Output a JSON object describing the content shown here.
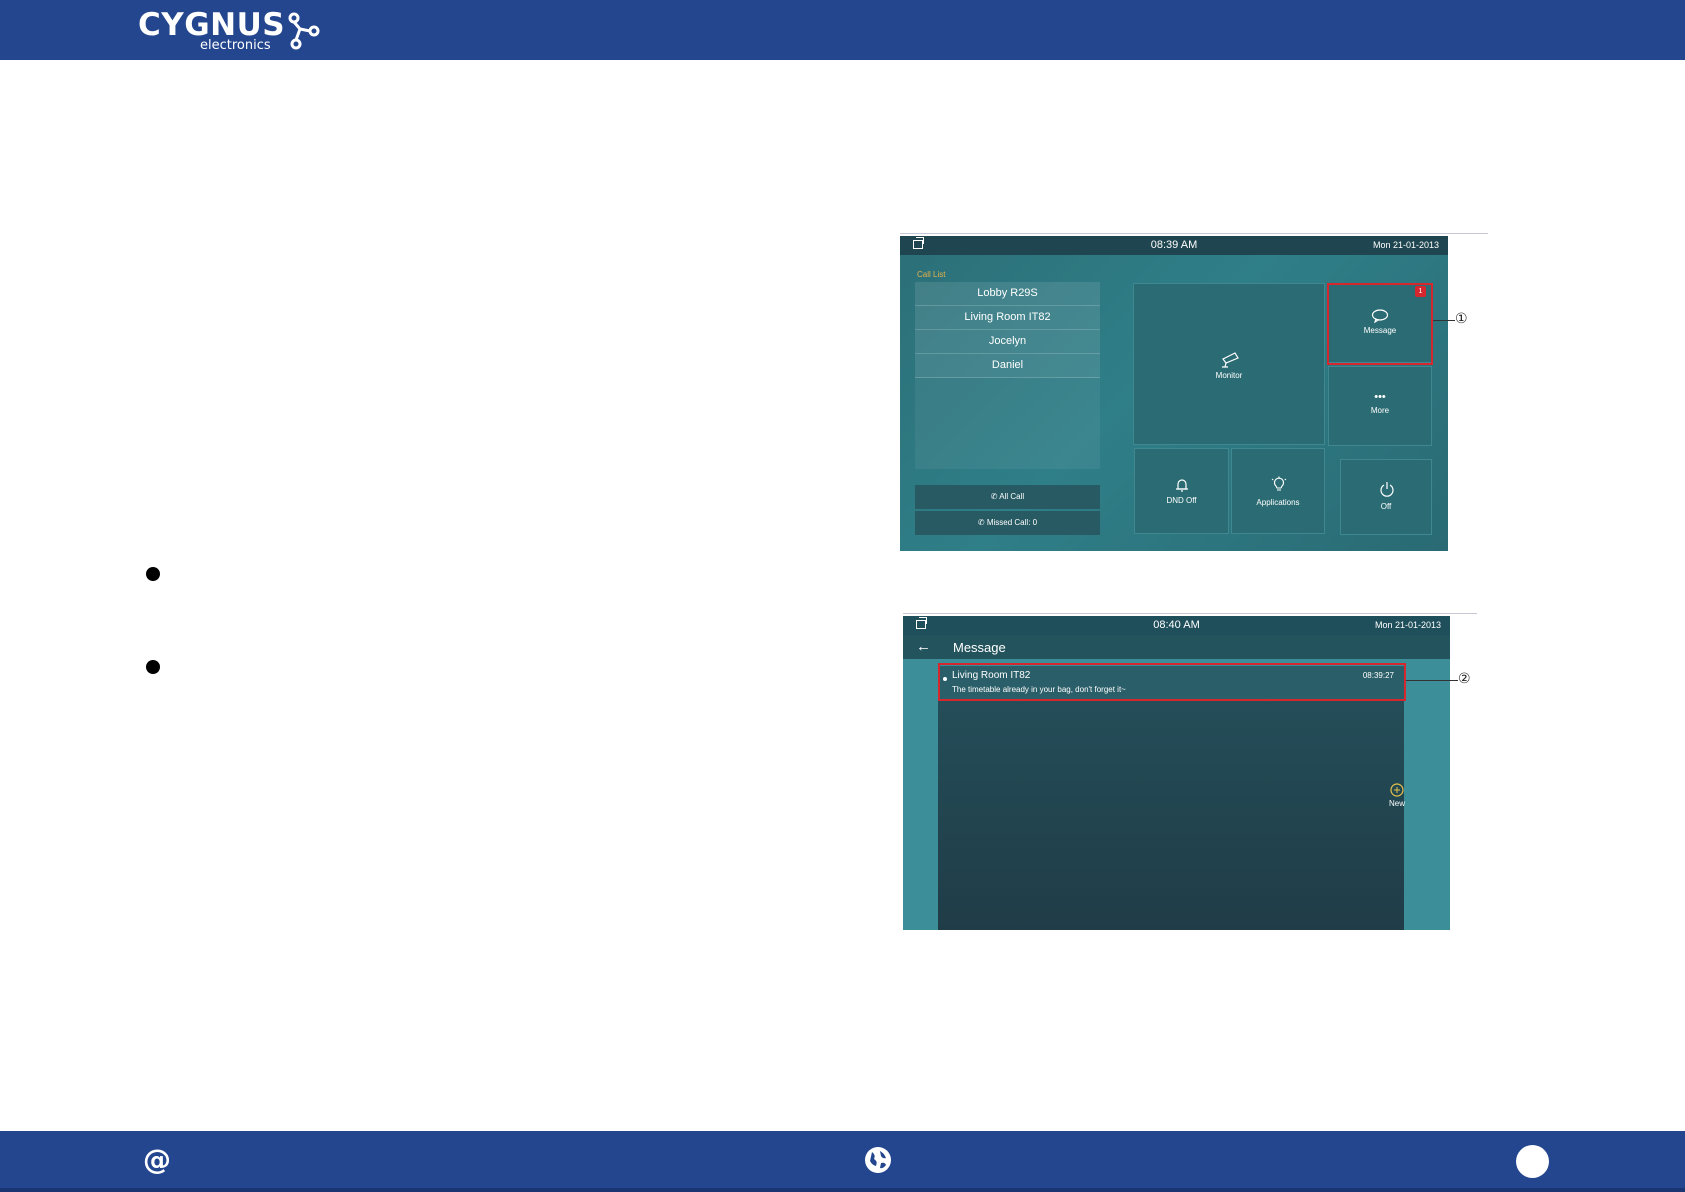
{
  "brand": {
    "name": "CYGNUS",
    "sub": "electronics"
  },
  "screen1": {
    "time": "08:39 AM",
    "date": "Mon   21-01-2013",
    "call_list_title": "Call List",
    "call_list": [
      "Lobby R29S",
      "Living Room IT82",
      "Jocelyn",
      "Daniel"
    ],
    "all_call": "All Call",
    "missed_call": "Missed Call: 0",
    "tiles": {
      "monitor": "Monitor",
      "message": "Message",
      "message_badge": "1",
      "more": "More",
      "dnd": "DND Off",
      "applications": "Applications",
      "off": "Off"
    },
    "callout": "①"
  },
  "screen2": {
    "time": "08:40 AM",
    "date": "Mon   21-01-2013",
    "title": "Message",
    "message": {
      "sender": "Living Room IT82",
      "time": "08:39:27",
      "text": "The timetable already in your bag, don't forget it~"
    },
    "new_label": "New",
    "callout": "②"
  },
  "footer": {
    "icons": [
      "at-icon",
      "globe-icon",
      "circle-icon"
    ]
  }
}
